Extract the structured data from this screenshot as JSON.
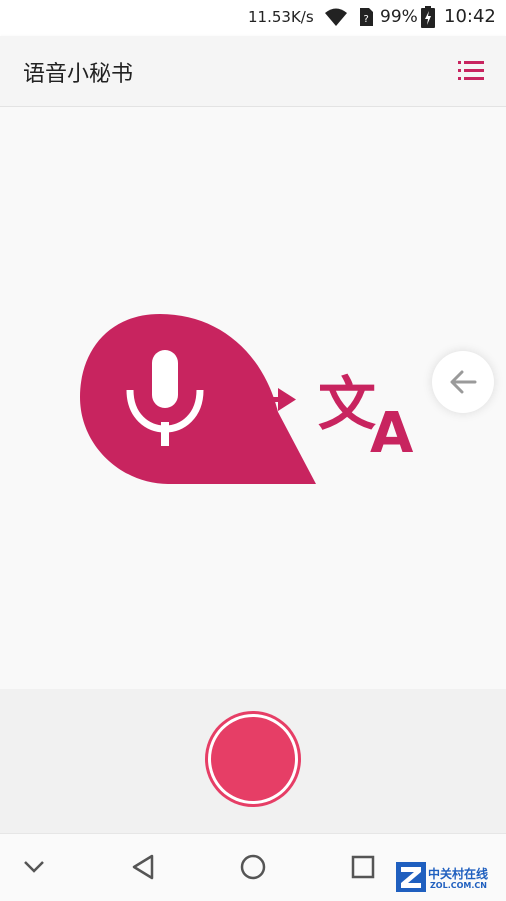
{
  "status_bar": {
    "network_speed": "11.53K/s",
    "battery_percent": "99%",
    "time": "10:42",
    "icons": [
      "wifi-icon",
      "sim-icon",
      "battery-charging-icon"
    ]
  },
  "app_bar": {
    "title": "语音小秘书",
    "menu_icon": "list-icon"
  },
  "colors": {
    "accent": "#c8245f",
    "record": "#e63e66"
  },
  "main": {
    "illustration_icons": [
      "microphone-bubble-icon",
      "arrow-right-icon",
      "translate-icon"
    ],
    "side_button_icon": "arrow-left-icon"
  },
  "record": {
    "icon": "record-icon"
  },
  "nav_bar": {
    "icons": [
      "chevron-down-icon",
      "back-triangle-icon",
      "home-circle-icon",
      "recents-square-icon"
    ]
  },
  "watermark": {
    "brand": "中关村在线",
    "site": "ZOL.COM.CN"
  }
}
